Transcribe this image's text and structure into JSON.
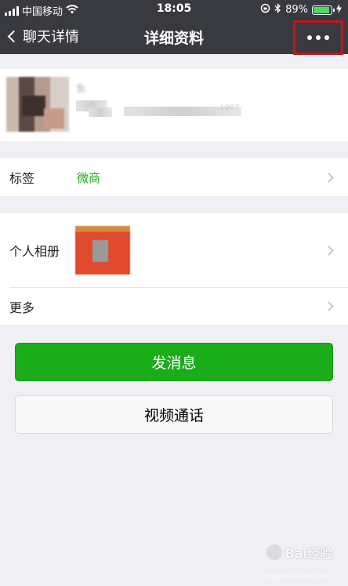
{
  "status_bar": {
    "carrier": "中国移动",
    "time": "18:05",
    "battery_percent_text": "89%",
    "battery_level": 0.89,
    "icons": [
      "signal-icon",
      "wifi-icon",
      "lock-rotation-icon",
      "bluetooth-icon",
      "battery-icon",
      "charging-icon"
    ]
  },
  "navbar": {
    "back_label": "聊天详情",
    "title": "详细资料",
    "more_icon": "more-dots-icon",
    "highlight_color": "#c4161c"
  },
  "profile": {
    "name_fragment": "鱼",
    "info_fragment": "1007"
  },
  "tags_row": {
    "label": "标签",
    "value": "微商"
  },
  "album_row": {
    "label": "个人相册"
  },
  "more_row": {
    "label": "更多"
  },
  "buttons": {
    "send_message": "发消息",
    "video_call": "视频通话"
  },
  "colors": {
    "navbar_bg": "#393a3f",
    "accent_green": "#1aad19",
    "page_bg": "#efeff4"
  },
  "watermark": {
    "text": "Bai经验",
    "url": "jingyan.baidu.com"
  }
}
